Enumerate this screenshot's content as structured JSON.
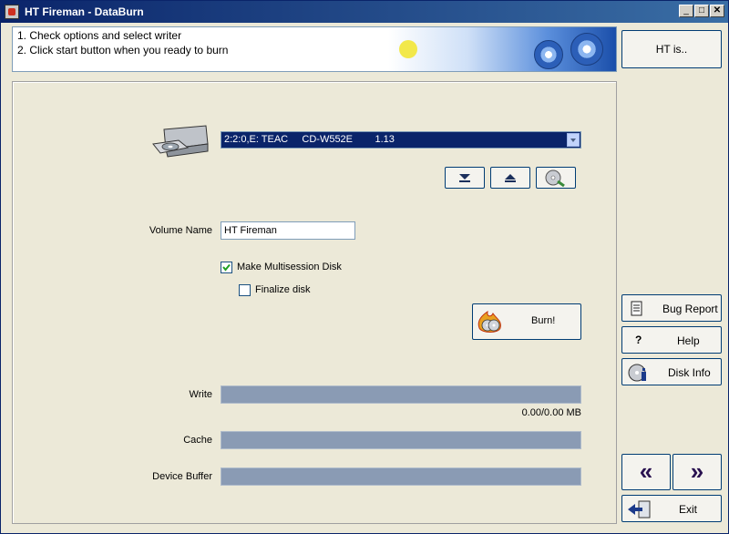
{
  "window": {
    "title": "HT Fireman - DataBurn"
  },
  "titlebar": {
    "minimize": "_",
    "maximize": "□",
    "close": "✕"
  },
  "instructions": {
    "line1": "1. Check options and select writer",
    "line2": "2. Click start button when you ready to burn"
  },
  "sidebar": {
    "about_label": "HT is..",
    "bug_report_label": "Bug Report",
    "help_label": "Help",
    "help_icon": "?",
    "disk_info_label": "Disk Info",
    "back_label": "«",
    "forward_label": "»",
    "exit_label": "Exit"
  },
  "drive": {
    "selected": "2:2:0,E: TEAC     CD-W552E        1.13"
  },
  "toolbar": {
    "load_icon": "load-tray-icon",
    "eject_icon": "eject-icon",
    "disc_search_icon": "disc-search-icon"
  },
  "volume": {
    "label": "Volume Name",
    "value": "HT Fireman"
  },
  "options": {
    "multisession_label": "Make Multisession Disk",
    "multisession_checked": true,
    "finalize_label": "Finalize disk",
    "finalize_checked": false
  },
  "burn": {
    "label": "Burn!"
  },
  "progress": {
    "write_label": "Write",
    "write_value": 0,
    "write_text": "0.00/0.00 MB",
    "cache_label": "Cache",
    "cache_value": 0,
    "device_buffer_label": "Device Buffer",
    "device_buffer_value": 0
  },
  "colors": {
    "title_start": "#0a246a",
    "title_end": "#3a6ea5",
    "bar_bg": "#8a9bb4",
    "selection": "#0a246a"
  }
}
